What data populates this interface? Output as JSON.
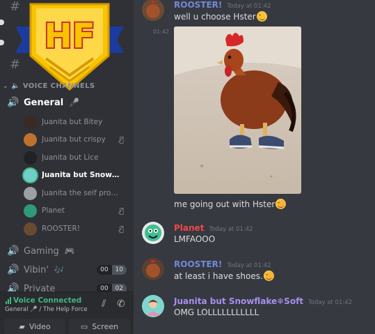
{
  "sidebar": {
    "text_channels": [
      {
        "icon": "hash-icon"
      },
      {
        "icon": "hash-icon"
      }
    ],
    "badge": {
      "text": "HF"
    },
    "voice_category": "VOICE CHANNELS",
    "general": {
      "name": "General",
      "emoji": "🎤"
    },
    "voice_users": [
      {
        "name": "Juanita but Bitey",
        "muted": false,
        "avatar_color": "#3a2a22"
      },
      {
        "name": "Juanita but crispy",
        "muted": true,
        "avatar_color": "#c0712b"
      },
      {
        "name": "Juanita but Lice",
        "muted": false,
        "avatar_color": "#222226"
      },
      {
        "name": "Juanita but Snowflake❄...",
        "muted": false,
        "speaking": true,
        "avatar_color": "#6fd0c9"
      },
      {
        "name": "Juanita the self proclaim...",
        "muted": false,
        "avatar_color": "#9aa0a6"
      },
      {
        "name": "Planet",
        "muted": true,
        "avatar_color": "#2f9a7a"
      },
      {
        "name": "ROOSTER!",
        "muted": true,
        "avatar_color": "#6b4a34"
      }
    ],
    "other_channels": [
      {
        "name": "Gaming",
        "emoji": "🎮"
      },
      {
        "name": "Vibin'",
        "emoji": "🎶",
        "count_a": "00",
        "count_b": "10"
      },
      {
        "name": "Private",
        "count_a": "00",
        "count_b": "02"
      }
    ]
  },
  "voice_panel": {
    "status": "Voice Connected",
    "channel_info": "General 🎤 / The Help Force",
    "video_label": "Video",
    "screen_label": "Screen"
  },
  "chat": {
    "messages": [
      {
        "author": "ROOSTER!",
        "author_color": "#7289da",
        "timestamp": "Today at 01:42",
        "text": "well u choose Hster",
        "emoji": "wink"
      },
      {
        "side_time": "01:42",
        "image": "rooster-in-sneakers"
      },
      {
        "text": "me going out with Hster",
        "emoji": "blush"
      },
      {
        "author": "Planet",
        "author_color": "#f04747",
        "timestamp": "Today at 01:42",
        "text": "LMFAOOO"
      },
      {
        "author": "ROOSTER!",
        "author_color": "#7289da",
        "timestamp": "Today at 01:42",
        "text": "at least i have shoes.",
        "emoji": "blush"
      },
      {
        "author": "Juanita but Snowflake❄Soft",
        "author_color": "#a98ef0",
        "timestamp": "Today at 01:42",
        "text": "OMG LOLLLLLLLLLLL"
      }
    ]
  },
  "colors": {
    "sidebar_bg": "#2f3136",
    "chat_bg": "#36393f",
    "connected_green": "#43b581",
    "badge_yellow": "#f8c400",
    "badge_blue": "#1b3c9e"
  }
}
